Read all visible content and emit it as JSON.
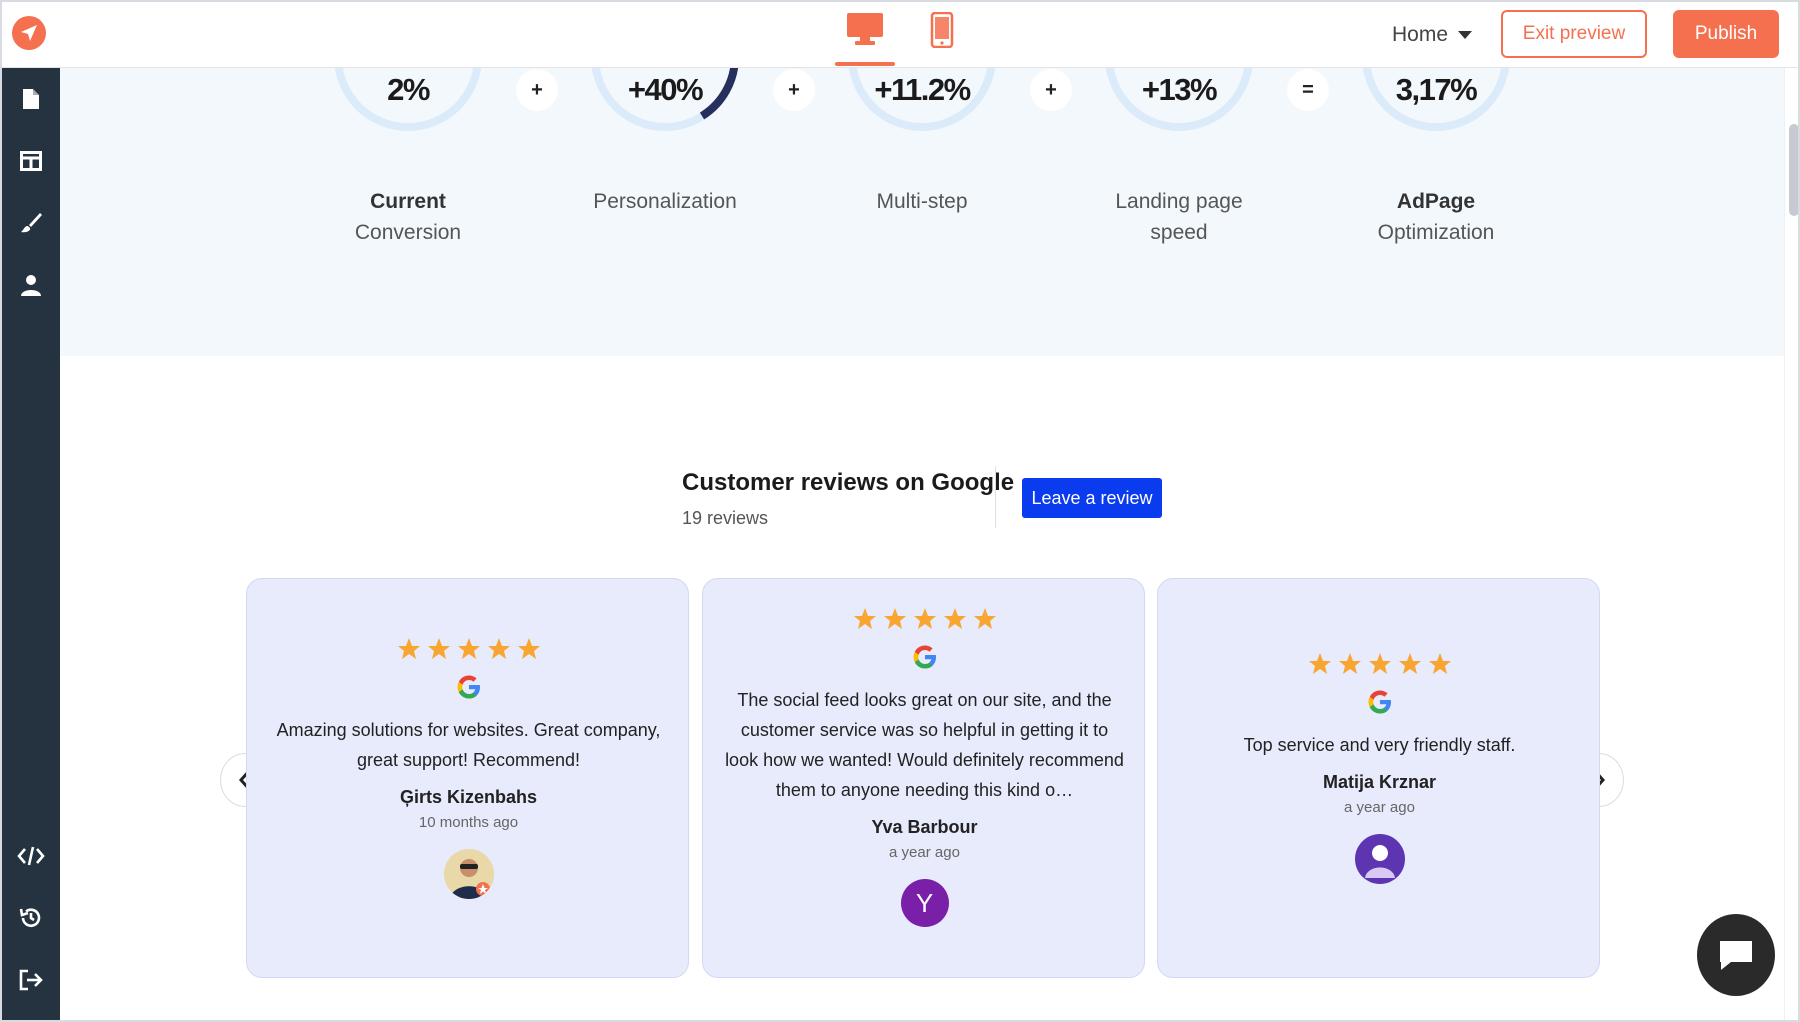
{
  "topbar": {
    "logo_icon": "paper-plane-logo-icon",
    "devices": [
      "desktop-icon",
      "mobile-icon"
    ],
    "page_select": "Home",
    "exit_label": "Exit preview",
    "publish_label": "Publish"
  },
  "sidebar": {
    "top_icons": [
      "page-icon",
      "layout-icon",
      "brush-icon",
      "user-icon"
    ],
    "bottom_icons": [
      "code-icon",
      "history-icon",
      "logout-icon"
    ]
  },
  "metrics": [
    {
      "value": "2%",
      "label_bold": "Current",
      "label": "Conversion",
      "progress": 0
    },
    {
      "value": "+40%",
      "label_bold": "",
      "label": "Personalization",
      "progress": 0.12
    },
    {
      "value": "+11.2%",
      "label_bold": "",
      "label": "Multi-step",
      "progress": 0
    },
    {
      "value": "+13%",
      "label_bold": "",
      "label": "Landing page speed",
      "progress": 0
    },
    {
      "value": "3,17%",
      "label_bold": "AdPage",
      "label": "Optimization",
      "progress": 0
    }
  ],
  "operators": [
    "+",
    "+",
    "+",
    "="
  ],
  "reviews_header": {
    "title": "Customer reviews on Google",
    "count": "19 reviews",
    "leave_label": "Leave a review"
  },
  "reviews": [
    {
      "stars": 5,
      "text": "Amazing solutions for websites. Great company, great support! Recommend!",
      "name": "Ģirts Kizenbahs",
      "time": "10 months ago",
      "avatar_type": "photo",
      "avatar_letter": ""
    },
    {
      "stars": 5,
      "text": "The social feed looks great on our site, and the customer service was so helpful in getting it to look how we wanted! Would definitely recommend them to anyone needing this kind o…",
      "name": "Yva Barbour",
      "time": "a year ago",
      "avatar_type": "letter",
      "avatar_letter": "Y"
    },
    {
      "stars": 5,
      "text": "Top service and very friendly staff.",
      "name": "Matija Krznar",
      "time": "a year ago",
      "avatar_type": "placeholder",
      "avatar_letter": ""
    }
  ],
  "colors": {
    "accent": "#f4704f",
    "sidebar": "#253341",
    "review_button": "#0a3bef",
    "card_bg": "#e7ebfc",
    "star": "#f8a532",
    "ring": "#dcebfa",
    "ring_progress": "#27305c"
  }
}
